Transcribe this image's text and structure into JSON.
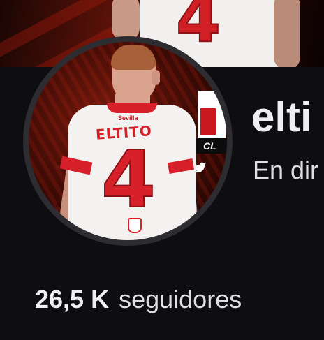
{
  "banner": {
    "shirt_number": "4"
  },
  "avatar": {
    "sponsor_text": "Sevilla",
    "shirt_name": "ELTITO",
    "shirt_number": "4",
    "tag_text": "CL",
    "social_icon": "twitter-icon"
  },
  "channel": {
    "name": "elti",
    "status": "En dir"
  },
  "followers": {
    "count": "26,5 K",
    "label": "seguidores"
  },
  "colors": {
    "background": "#0e0e10",
    "accent_red": "#d6212a",
    "text_primary": "#efeff1"
  }
}
